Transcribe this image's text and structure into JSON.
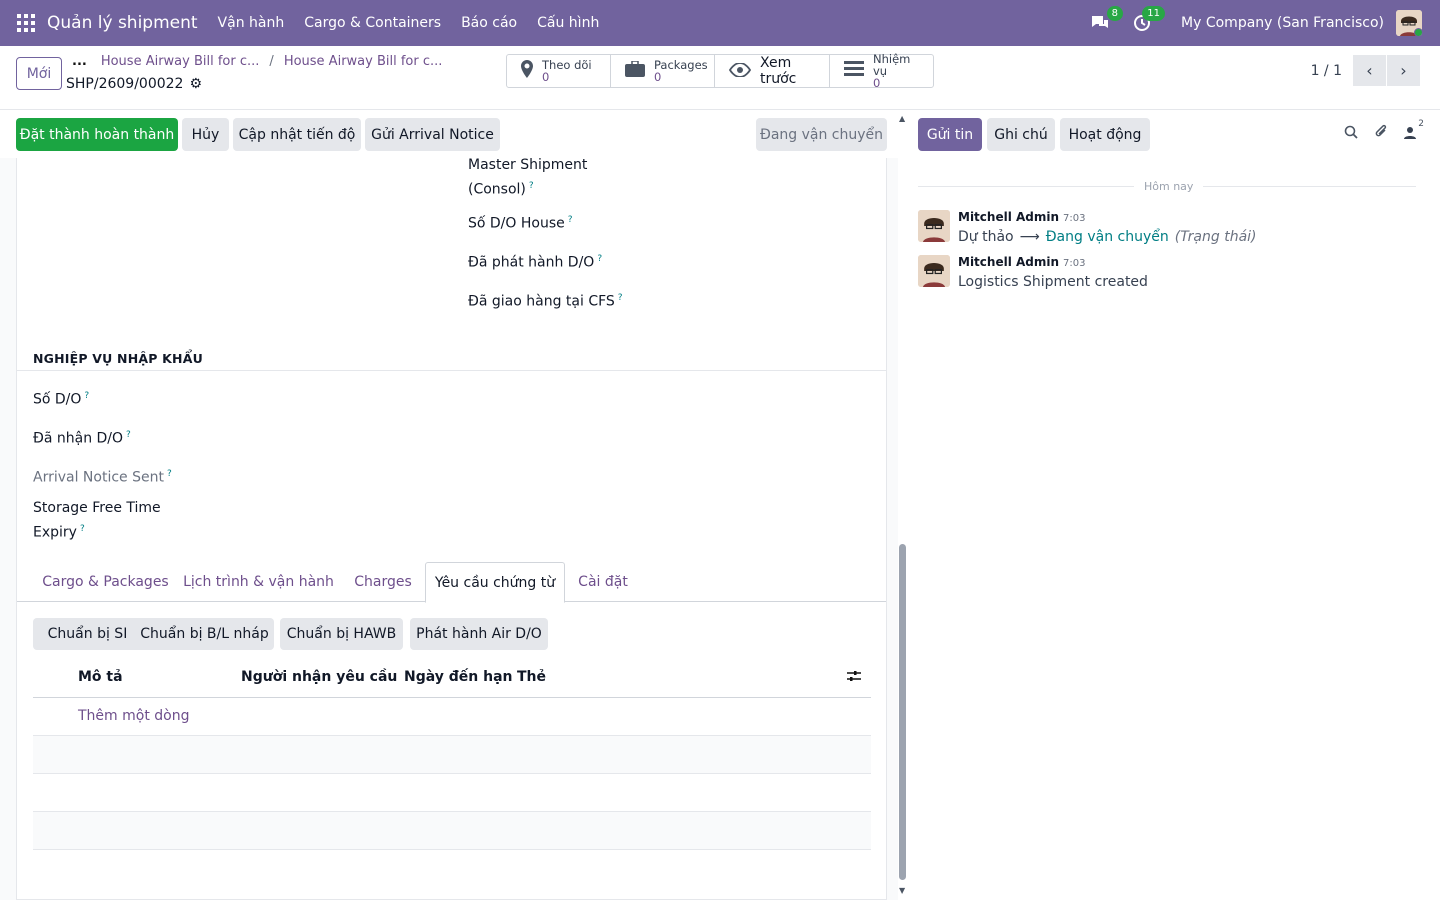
{
  "navbar": {
    "app_name": "Quản lý shipment",
    "menu": [
      "Vận hành",
      "Cargo & Containers",
      "Báo cáo",
      "Cấu hình"
    ],
    "messages_count": "8",
    "activities_count": "11",
    "company": "My Company (San Francisco)"
  },
  "control": {
    "new_label": "Mới",
    "breadcrumb_ellipsis": "...",
    "breadcrumbs": [
      "House Airway Bill for c...",
      "House Airway Bill for c..."
    ],
    "record_id": "SHP/2609/00022",
    "smart_buttons": {
      "follow": {
        "label": "Theo dõi",
        "value": "0"
      },
      "packages": {
        "label": "Packages",
        "value": "0"
      },
      "preview": {
        "label": "Xem trước"
      },
      "tasks": {
        "label": "Nhiệm vụ",
        "value": "0"
      }
    },
    "pager": "1 / 1"
  },
  "statusbar": {
    "buttons": [
      "Đặt thành hoàn thành",
      "Hủy",
      "Cập nhật tiến độ",
      "Gửi Arrival Notice"
    ],
    "state": "Đang vận chuyển"
  },
  "form": {
    "fields_right": [
      "Master Shipment",
      "(Consol)",
      "Số D/O House",
      "Đã phát hành D/O",
      "Đã giao hàng tại CFS"
    ],
    "section_title": "NGHIỆP VỤ NHẬP KHẨU",
    "fields_import": [
      "Số D/O",
      "Đã nhận D/O",
      "Arrival Notice Sent",
      "Storage Free Time",
      "Expiry"
    ],
    "help_mark": "?",
    "tabs": [
      "Cargo & Packages",
      "Lịch trình & vận hành",
      "Charges",
      "Yêu cầu chứng từ",
      "Cài đặt"
    ],
    "active_tab": "Yêu cầu chứng từ",
    "doc_buttons": [
      "Chuẩn bị SI",
      "Chuẩn bị B/L nháp",
      "Chuẩn bị HAWB",
      "Phát hành Air D/O"
    ],
    "columns": [
      "Mô tả",
      "Người nhận yêu cầu",
      "Ngày đến hạn",
      "Thẻ"
    ],
    "add_line": "Thêm một dòng"
  },
  "chatter": {
    "buttons": [
      "Gửi tin",
      "Ghi chú",
      "Hoạt động"
    ],
    "followers_count": "2",
    "day_label": "Hôm nay",
    "messages": [
      {
        "author": "Mitchell Admin",
        "time": "7:03",
        "old_value": "Dự thảo",
        "new_value": "Đang vận chuyển",
        "field": "(Trạng thái)"
      },
      {
        "author": "Mitchell Admin",
        "time": "7:03",
        "body": "Logistics Shipment created"
      }
    ]
  },
  "colors": {
    "brand": "#71639e",
    "primary_action": "#1ba542",
    "link": "#017e84"
  }
}
